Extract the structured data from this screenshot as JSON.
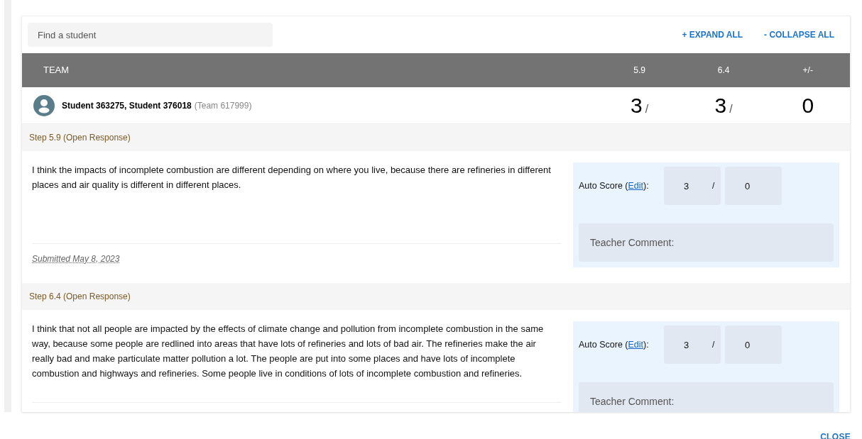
{
  "search": {
    "placeholder": "Find a student"
  },
  "actions": [
    "+ EXPAND ALL",
    "- COLLAPSE ALL"
  ],
  "table": {
    "columns": [
      "TEAM",
      "5.9",
      "6.4",
      "+/-"
    ],
    "row": {
      "students": "Student 363275, Student 376018",
      "team": "(Team 617999)",
      "scores": [
        {
          "value": "3",
          "suffix": "/"
        },
        {
          "value": "3",
          "suffix": "/"
        },
        {
          "value": "0"
        }
      ]
    }
  },
  "steps": [
    {
      "title": "Step 5.9 (Open Response)",
      "response": "I think the impacts of incomplete combustion are different depending on where you live, because there are refineries in different places and air quality is different in different places.",
      "submitted": "Submitted May 8, 2023",
      "score_label": "Auto Score (",
      "edit_link": "Edit",
      "score_label_end": "):",
      "score": "3",
      "separator": "/",
      "max": "0",
      "comment_placeholder": "Teacher Comment:"
    },
    {
      "title": "Step 6.4 (Open Response)",
      "response": "I think that not all people are impacted by the effects of climate change and pollution from incomplete combustion in the same way, because some people are redlined into areas that have lots of refineries and lots of bad air. The refineries make the air really bad and make particulate matter pollution a lot. The people are put into some places and have lots of incomplete combustion and highways and refineries. Some people live in conditions of lots of incomplete combustion and refineries.",
      "score_label": "Auto Score (",
      "edit_link": "Edit",
      "score_label_end": "):",
      "score": "3",
      "separator": "/",
      "max": "0",
      "comment_placeholder": "Teacher Comment:"
    }
  ],
  "close": "CLOSE"
}
